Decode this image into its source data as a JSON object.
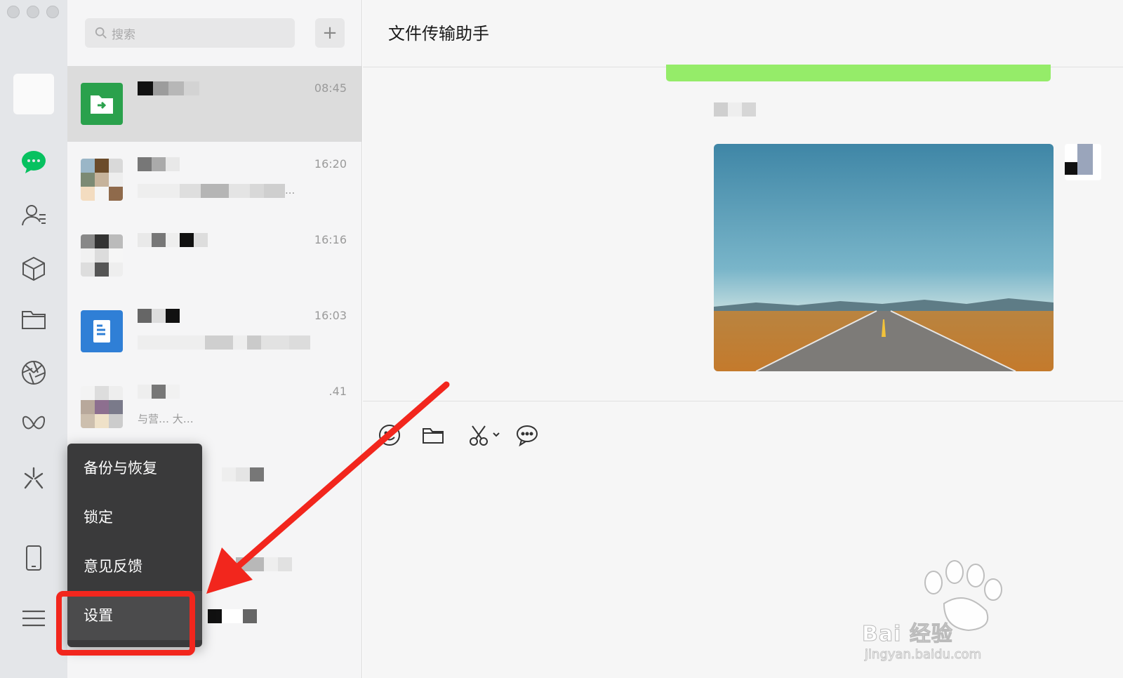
{
  "window": {
    "title": "文件传输助手"
  },
  "search": {
    "placeholder": "搜索",
    "add_label": "+"
  },
  "chats": [
    {
      "time": "08:45",
      "preview": ""
    },
    {
      "time": "16:20",
      "preview": "..."
    },
    {
      "time": "16:16",
      "preview": ""
    },
    {
      "time": "16:03",
      "preview": ""
    },
    {
      "time": ".41",
      "preview": "与营…   大…"
    }
  ],
  "menu": {
    "items": [
      {
        "label": "备份与恢复"
      },
      {
        "label": "锁定"
      },
      {
        "label": "意见反馈"
      },
      {
        "label": "设置"
      }
    ]
  },
  "watermark": {
    "brand": "Bai 经验",
    "url": "jingyan.baidu.com"
  },
  "colors": {
    "accent": "#07c160",
    "bubble": "#95ec69",
    "highlight": "#f2261d"
  },
  "icons": [
    "chat-icon",
    "contacts-icon",
    "favorites-icon",
    "files-icon",
    "moments-icon",
    "channels-icon",
    "miniprogram-icon",
    "phone-icon",
    "menu-icon",
    "emoji-icon",
    "folder-icon",
    "scissors-icon",
    "comment-icon"
  ]
}
